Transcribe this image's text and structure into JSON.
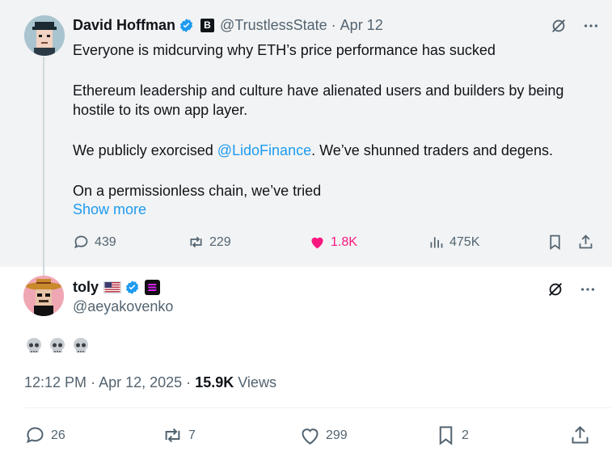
{
  "quoted_tweet": {
    "author_name": "David Hoffman",
    "badge_letter": "B",
    "handle": "@TrustlessState",
    "separator": "·",
    "date": "Apr 12",
    "line1": "Everyone is midcurving why ETH’s price performance has sucked",
    "line2": "Ethereum leadership and culture have alienated users and builders by being hostile to its own app layer.",
    "line3_prefix": "We publicly exorcised ",
    "line3_mention": "@LidoFinance",
    "line3_suffix": ". We’ve shunned traders and degens.",
    "line4": "On a permissionless chain, we’ve tried",
    "show_more": "Show more",
    "replies": "439",
    "reposts": "229",
    "likes": "1.8K",
    "views": "475K"
  },
  "main_tweet": {
    "author_name": "toly",
    "handle": "@aeyakovenko",
    "time": "12:12 PM",
    "date": "Apr 12, 2025",
    "dot": "·",
    "views_count": "15.9K",
    "views_label": "Views",
    "replies": "26",
    "reposts": "7",
    "likes": "299",
    "bookmarks": "2"
  },
  "colors": {
    "accent": "#1d9bf0",
    "like": "#f91880",
    "muted": "#536471",
    "quoted_bg": "#f2f3f4"
  },
  "icons": [
    "verified-badge-icon",
    "grok-icon",
    "more-icon",
    "reply-icon",
    "repost-icon",
    "heart-icon",
    "views-icon",
    "bookmark-icon",
    "share-icon",
    "skull-emoji",
    "us-flag-icon"
  ]
}
